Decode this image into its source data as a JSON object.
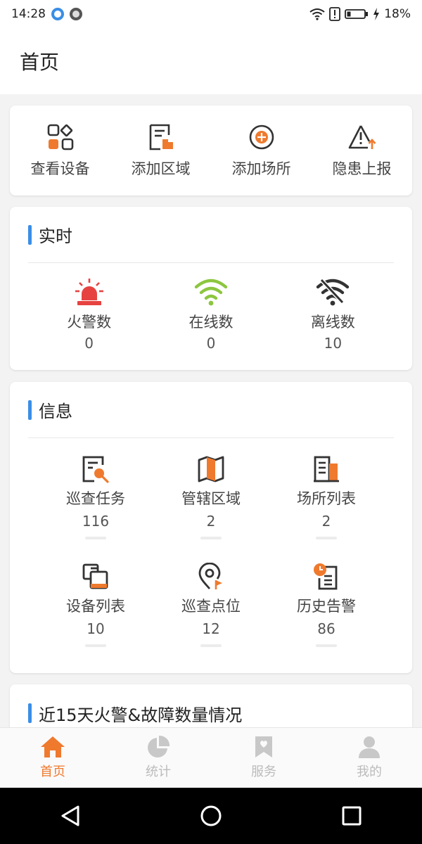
{
  "status_bar": {
    "time": "14:28",
    "battery": "18%"
  },
  "header": {
    "title": "首页"
  },
  "quick_actions": [
    {
      "label": "查看设备",
      "icon": "device-grid-icon"
    },
    {
      "label": "添加区域",
      "icon": "add-area-icon"
    },
    {
      "label": "添加场所",
      "icon": "add-place-icon"
    },
    {
      "label": "隐患上报",
      "icon": "hazard-report-icon"
    }
  ],
  "realtime": {
    "title": "实时",
    "items": [
      {
        "label": "火警数",
        "value": "0",
        "icon": "alarm-siren-icon"
      },
      {
        "label": "在线数",
        "value": "0",
        "icon": "wifi-online-icon"
      },
      {
        "label": "离线数",
        "value": "10",
        "icon": "wifi-offline-icon"
      }
    ]
  },
  "info": {
    "title": "信息",
    "items": [
      {
        "label": "巡查任务",
        "value": "116",
        "icon": "inspection-task-icon"
      },
      {
        "label": "管辖区域",
        "value": "2",
        "icon": "map-icon"
      },
      {
        "label": "场所列表",
        "value": "2",
        "icon": "building-icon"
      },
      {
        "label": "设备列表",
        "value": "10",
        "icon": "device-list-icon"
      },
      {
        "label": "巡查点位",
        "value": "12",
        "icon": "location-pin-icon"
      },
      {
        "label": "历史告警",
        "value": "86",
        "icon": "history-alarm-icon"
      }
    ]
  },
  "chart_section": {
    "title": "近15天火警&故障数量情况"
  },
  "tabs": [
    {
      "label": "首页",
      "icon": "home-icon",
      "active": true
    },
    {
      "label": "统计",
      "icon": "pie-chart-icon",
      "active": false
    },
    {
      "label": "服务",
      "icon": "service-icon",
      "active": false
    },
    {
      "label": "我的",
      "icon": "user-icon",
      "active": false
    }
  ],
  "colors": {
    "accent": "#ef7a2e",
    "section_bar": "#3a8ee6",
    "alarm": "#e64340",
    "online": "#8cc63f",
    "icon_dark": "#333333"
  }
}
